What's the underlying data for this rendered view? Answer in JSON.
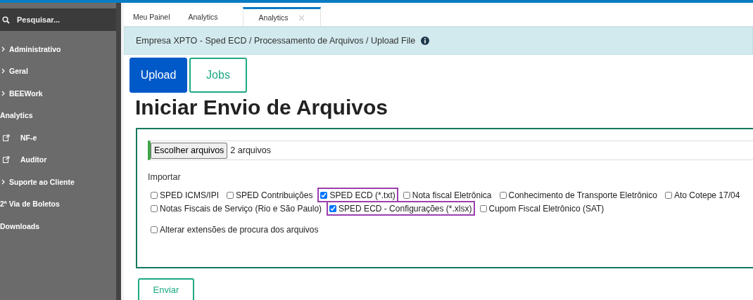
{
  "sidebar": {
    "search": {
      "placeholder": "Pesquisar..."
    },
    "items": [
      {
        "label": "Administrativo",
        "kind": "group"
      },
      {
        "label": "Geral",
        "kind": "group"
      },
      {
        "label": "BEEWork",
        "kind": "group"
      },
      {
        "label": "Analytics",
        "kind": "plain"
      },
      {
        "label": "NF-e",
        "kind": "link"
      },
      {
        "label": "Auditor",
        "kind": "link"
      },
      {
        "label": "Suporte ao Cliente",
        "kind": "group"
      },
      {
        "label": "2ª Via de Boletos",
        "kind": "plain"
      },
      {
        "label": "Downloads",
        "kind": "plain"
      }
    ]
  },
  "tabs": [
    {
      "label": "Meu Painel",
      "selected": false,
      "closable": false
    },
    {
      "label": "Analytics",
      "selected": false,
      "closable": false
    },
    {
      "label": "Analytics",
      "selected": true,
      "closable": true
    }
  ],
  "breadcrumb": "Empresa XPTO - Sped ECD / Processamento de Arquivos / Upload File",
  "mode_buttons": [
    {
      "label": "Upload",
      "selected": true
    },
    {
      "label": "Jobs",
      "selected": false
    }
  ],
  "heading": "Iniciar Envio de Arquivos",
  "file_input": {
    "button": "Escolher arquivos",
    "value": "2 arquivos"
  },
  "import_label": "Importar",
  "option_rows": [
    [
      {
        "label": "SPED ICMS/IPI",
        "checked": false,
        "highlighted": false
      },
      {
        "label": "SPED Contribuições",
        "checked": false,
        "highlighted": false
      },
      {
        "label": "SPED ECD (*.txt)",
        "checked": true,
        "highlighted": true
      },
      {
        "label": "Nota fiscal Eletrônica",
        "checked": false,
        "highlighted": false
      },
      {
        "label": "Conhecimento de Transporte Eletrônico",
        "checked": false,
        "highlighted": false
      },
      {
        "label": "Ato Cotepe 17/04",
        "checked": false,
        "highlighted": false
      }
    ],
    [
      {
        "label": "Notas Fiscais de Serviço (Rio e São Paulo)",
        "checked": false,
        "highlighted": false
      },
      {
        "label": "SPED ECD - Configurações (*.xlsx)",
        "checked": true,
        "highlighted": true
      },
      {
        "label": "Cupom Fiscal Eletrônico (SAT)",
        "checked": false,
        "highlighted": false
      }
    ]
  ],
  "alter_extensions": {
    "label": "Alterar extensões de procura dos arquivos",
    "checked": false
  },
  "submit": "Enviar"
}
